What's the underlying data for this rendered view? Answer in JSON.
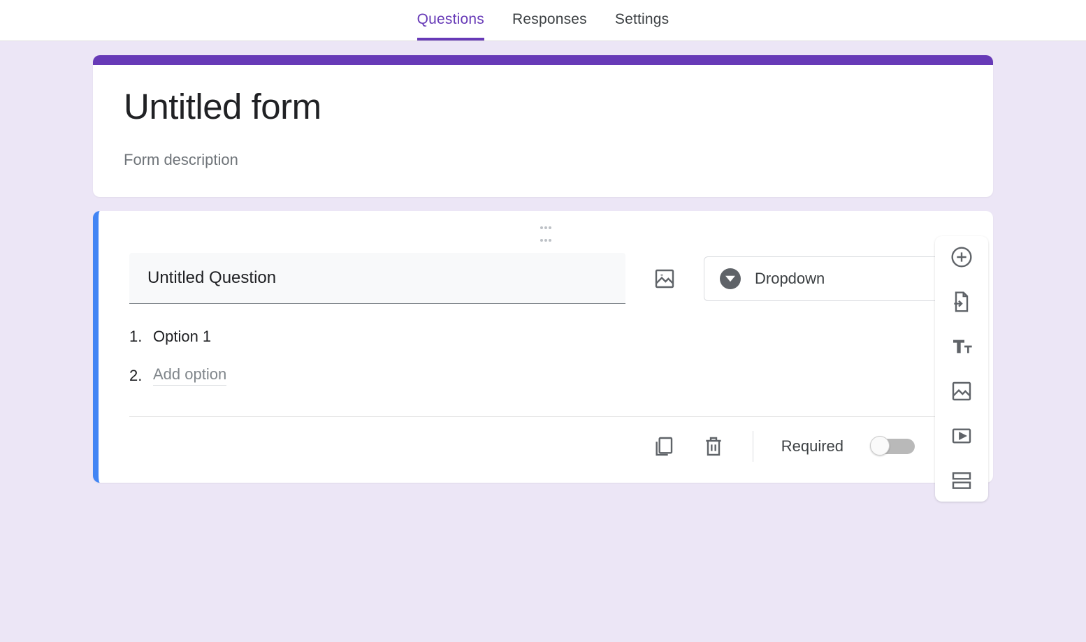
{
  "tabs": {
    "questions": "Questions",
    "responses": "Responses",
    "settings": "Settings"
  },
  "form": {
    "title": "Untitled form",
    "description": "Form description"
  },
  "question": {
    "text": "Untitled Question",
    "type_label": "Dropdown",
    "options": [
      {
        "num": "1.",
        "label": "Option 1"
      }
    ],
    "add_option_num": "2.",
    "add_option_placeholder": "Add option"
  },
  "footer": {
    "required_label": "Required"
  }
}
